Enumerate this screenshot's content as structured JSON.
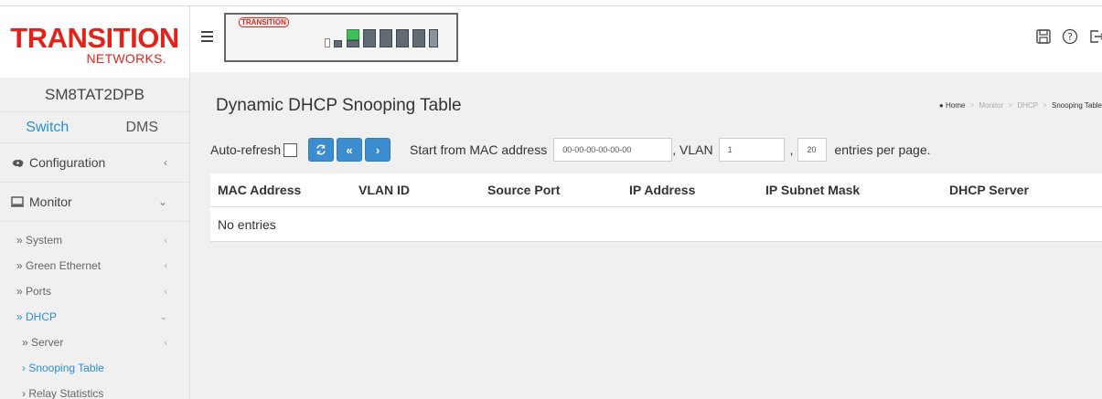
{
  "brand": {
    "logo_main": "TRANSITION",
    "logo_sub": "NETWORKS.",
    "device_logo": "TRANSITION"
  },
  "device_name": "SM8TAT2DPB",
  "tabs": [
    {
      "label": "Switch",
      "active": true
    },
    {
      "label": "DMS",
      "active": false
    }
  ],
  "menu": {
    "configuration": "Configuration",
    "monitor": "Monitor",
    "sub": [
      {
        "label": "» System"
      },
      {
        "label": "» Green Ethernet"
      },
      {
        "label": "» Ports"
      },
      {
        "label": "» DHCP"
      }
    ],
    "dhcp_sub": [
      {
        "label": "» Server"
      },
      {
        "label": "› Snooping Table"
      },
      {
        "label": "› Relay Statistics"
      }
    ]
  },
  "page": {
    "title": "Dynamic DHCP Snooping Table",
    "breadcrumb": {
      "home": "Home",
      "items": [
        "Monitor",
        "DHCP"
      ],
      "current": "Snooping Table"
    }
  },
  "controls": {
    "auto_refresh_label": "Auto-refresh",
    "auto_refresh_checked": false,
    "start_label": "Start from MAC address",
    "mac_value": "00-00-00-00-00-00",
    "vlan_label": ", VLAN",
    "vlan_value": "1",
    "comma": ",",
    "entries_value": "20",
    "entries_label": "entries per page."
  },
  "table": {
    "columns": [
      "MAC Address",
      "VLAN ID",
      "Source Port",
      "IP Address",
      "IP Subnet Mask",
      "DHCP Server"
    ],
    "empty_text": "No entries"
  },
  "colors": {
    "accent": "#2b8fd4",
    "button": "#3c8dd0",
    "brand_red": "#e2231a"
  },
  "icons": {
    "save": "save-icon",
    "help": "help-icon",
    "logout": "logout-icon"
  }
}
